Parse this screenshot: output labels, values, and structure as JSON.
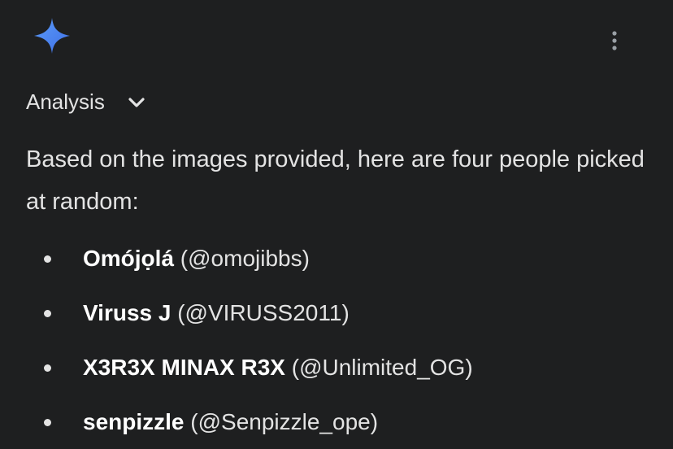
{
  "header": {
    "logo_icon": "gemini-spark-icon",
    "more_icon": "more-vert-icon",
    "accent_color": "#4c8df6"
  },
  "analysis": {
    "label": "Analysis",
    "icon": "chevron-down-icon"
  },
  "response": {
    "intro": "Based on the images provided, here are four people picked at random:",
    "people": [
      {
        "name": "Omójọlá",
        "handle": "(@omojibbs)"
      },
      {
        "name": "Viruss J",
        "handle": "(@VIRUSS2011)"
      },
      {
        "name": "X3R3X MINAX R3X",
        "handle": "(@Unlimited_OG)"
      },
      {
        "name": "senpizzle",
        "handle": "(@Senpizzle_ope)"
      }
    ]
  }
}
